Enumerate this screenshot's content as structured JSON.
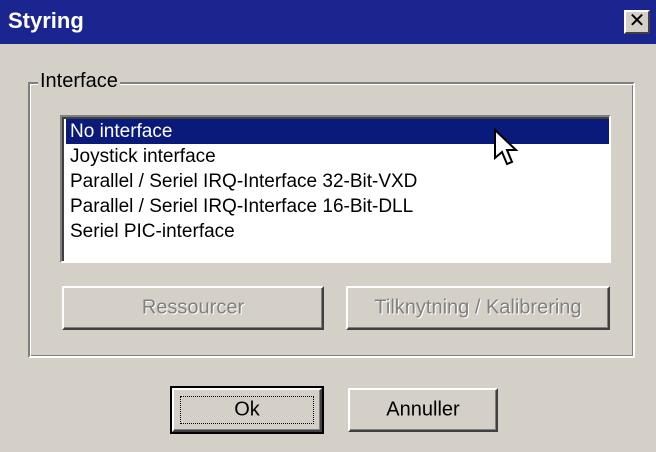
{
  "window": {
    "title": "Styring",
    "close_glyph": "✕"
  },
  "group": {
    "legend": "Interface"
  },
  "listbox": {
    "items": [
      "No interface",
      "Joystick interface",
      "Parallel / Seriel IRQ-Interface 32-Bit-VXD",
      "Parallel / Seriel IRQ-Interface 16-Bit-DLL",
      "Seriel PIC-interface"
    ],
    "selected_index": 0
  },
  "buttons": {
    "resources": "Ressourcer",
    "connect_calibrate": "Tilknytning / Kalibrering",
    "ok": "Ok",
    "cancel": "Annuller"
  },
  "colors": {
    "titlebar": "#1a2590",
    "selection": "#0a1a7a",
    "face": "#d4d0c8"
  },
  "icons": {
    "close": "close-icon",
    "cursor": "mouse-cursor-icon"
  }
}
